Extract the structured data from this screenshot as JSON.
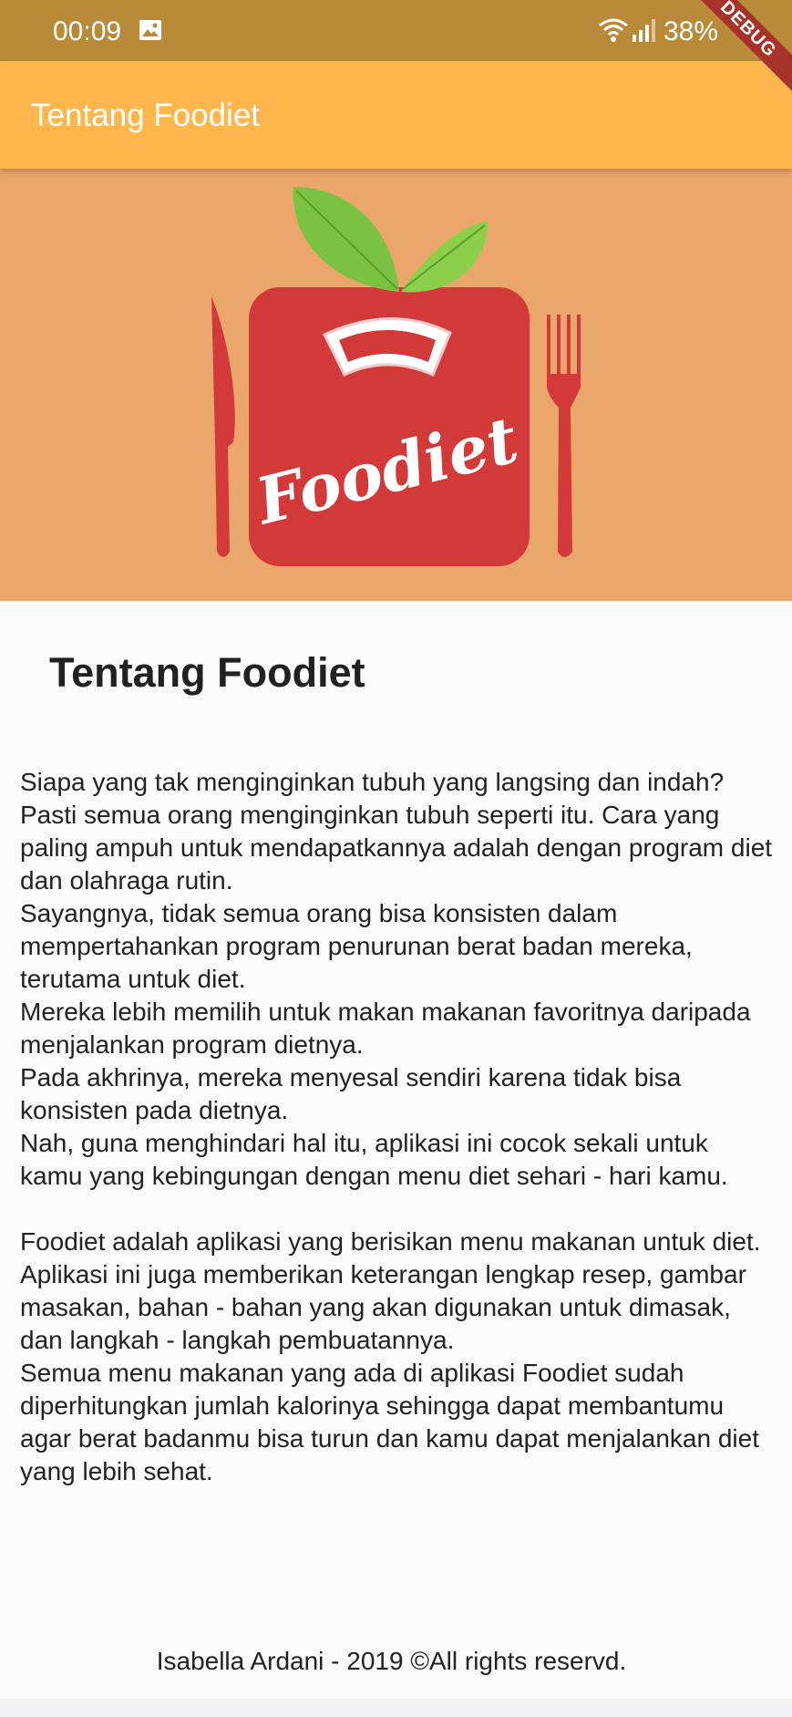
{
  "status_bar": {
    "time": "00:09",
    "battery": "38%",
    "icons": [
      "image-icon",
      "wifi-icon",
      "signal-icon"
    ]
  },
  "debug_banner": "DEBUG",
  "app_bar": {
    "title": "Tentang Foodiet"
  },
  "hero": {
    "logo_text": "Foodiet"
  },
  "content": {
    "heading": "Tentang Foodiet",
    "paragraph": "Siapa yang tak menginginkan tubuh yang langsing dan indah?\nPasti semua orang menginginkan tubuh seperti itu. Cara yang paling ampuh untuk mendapatkannya adalah dengan program diet dan olahraga rutin.\nSayangnya, tidak semua orang bisa konsisten dalam mempertahankan program penurunan berat badan mereka, terutama untuk diet.\nMereka lebih memilih untuk makan makanan favoritnya daripada menjalankan program dietnya.\nPada akhrinya, mereka menyesal sendiri karena tidak bisa konsisten pada dietnya.\nNah, guna menghindari hal itu, aplikasi ini cocok sekali untuk kamu yang kebingungan dengan menu diet sehari - hari kamu.\n\nFoodiet adalah aplikasi yang berisikan menu makanan untuk diet. Aplikasi ini juga memberikan keterangan lengkap resep, gambar masakan, bahan - bahan yang akan digunakan untuk dimasak, dan langkah - langkah pembuatannya.\nSemua menu makanan yang ada di aplikasi Foodiet sudah diperhitungkan jumlah kalorinya sehingga dapat membantumu agar berat badanmu bisa turun dan kamu dapat menjalankan diet yang lebih sehat."
  },
  "footer": {
    "text": "Isabella Ardani - 2019 ©All rights reservd."
  },
  "colors": {
    "status_bar": "#b98b38",
    "app_bar": "#ffb74d",
    "hero_bg": "#eba66c",
    "logo_red": "#d23a3a",
    "leaf_green": "#7cc242",
    "debug_ribbon": "#a5332a"
  }
}
